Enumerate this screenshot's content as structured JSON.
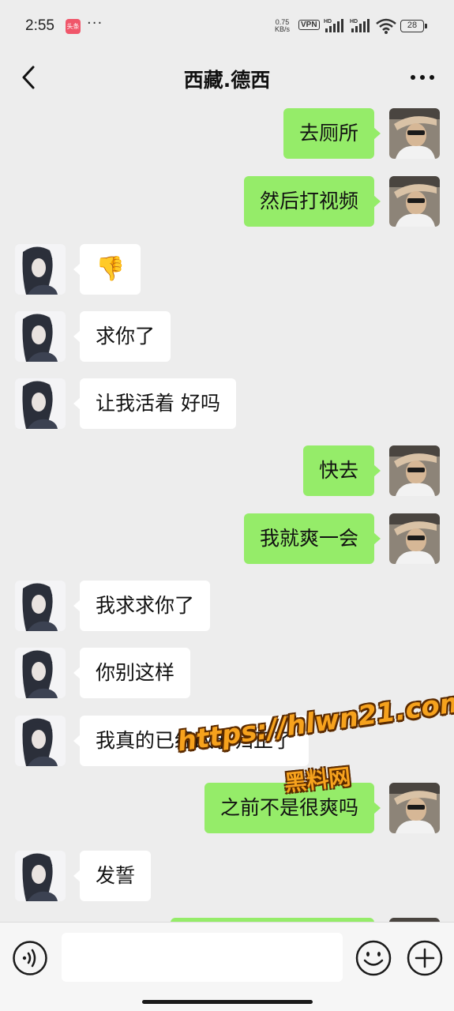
{
  "status_bar": {
    "time": "2:55",
    "app_badge": "头条",
    "dots": "···",
    "speed_value": "0.75",
    "speed_unit": "KB/s",
    "vpn": "VPN",
    "hd1": "HD",
    "hd2": "HD",
    "battery": "28"
  },
  "header": {
    "title": "西藏.德西"
  },
  "messages": [
    {
      "side": "right",
      "text": "去厕所"
    },
    {
      "side": "right",
      "text": "然后打视频"
    },
    {
      "side": "left",
      "text": "👎"
    },
    {
      "side": "left",
      "text": "求你了"
    },
    {
      "side": "left",
      "text": "让我活着 好吗"
    },
    {
      "side": "right",
      "text": "快去"
    },
    {
      "side": "right",
      "text": "我就爽一会"
    },
    {
      "side": "left",
      "text": "我求求你了"
    },
    {
      "side": "left",
      "text": "你别这样"
    },
    {
      "side": "left",
      "text": "我真的已经改邪归正了"
    },
    {
      "side": "right",
      "text": "之前不是很爽吗"
    },
    {
      "side": "left",
      "text": "发誓"
    }
  ],
  "input_bar": {
    "placeholder": "",
    "icons": [
      "voice-icon",
      "emoji-icon",
      "plus-icon"
    ]
  },
  "watermark": {
    "line1": "https://hlwn21.com",
    "line2": "黑料网"
  },
  "colors": {
    "background": "#ededed",
    "sent_bubble": "#95ec69",
    "received_bubble": "#ffffff",
    "watermark": "#f6a21d"
  }
}
